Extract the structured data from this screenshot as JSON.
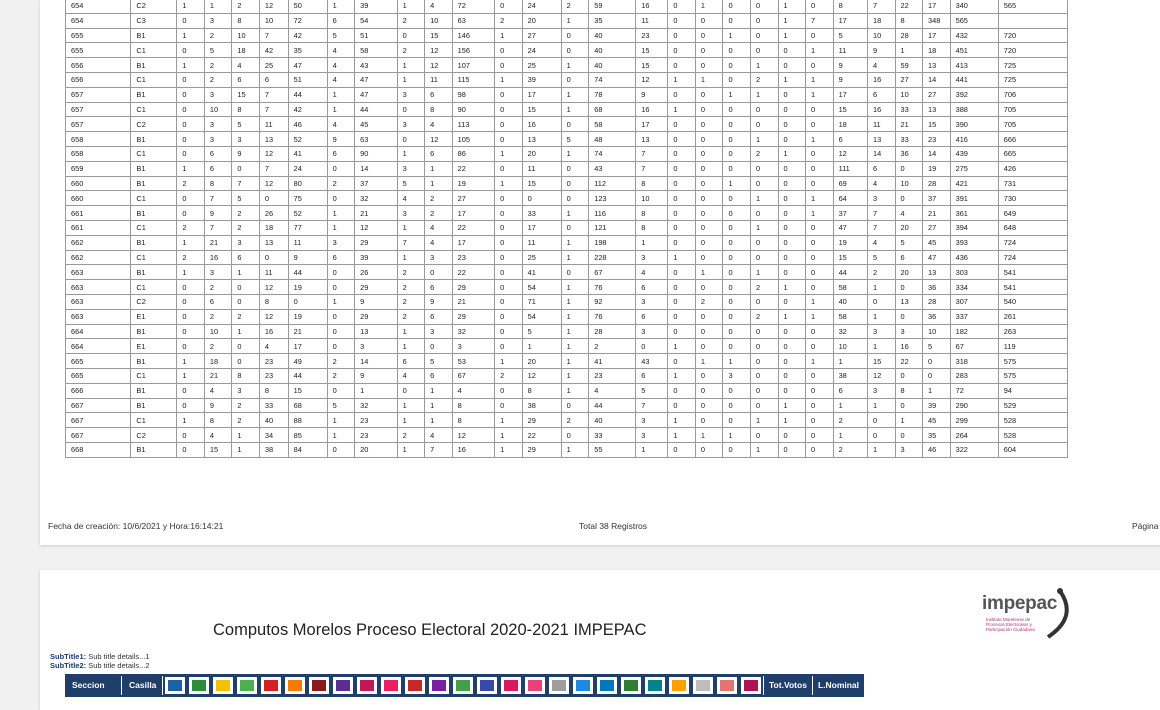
{
  "table": {
    "rows": [
      [
        "654",
        "C2",
        "1",
        "1",
        "2",
        "12",
        "50",
        "1",
        "39",
        "1",
        "4",
        "72",
        "0",
        "24",
        "2",
        "59",
        "16",
        "0",
        "1",
        "0",
        "0",
        "1",
        "0",
        "8",
        "7",
        "22",
        "17",
        "340",
        "565"
      ],
      [
        "654",
        "C3",
        "0",
        "3",
        "8",
        "10",
        "72",
        "6",
        "54",
        "2",
        "10",
        "63",
        "2",
        "20",
        "1",
        "35",
        "11",
        "0",
        "0",
        "0",
        "0",
        "1",
        "7",
        "17",
        "18",
        "8",
        "348",
        "565",
        ""
      ],
      [
        "655",
        "B1",
        "1",
        "2",
        "10",
        "7",
        "42",
        "5",
        "51",
        "0",
        "15",
        "146",
        "1",
        "27",
        "0",
        "40",
        "23",
        "0",
        "0",
        "1",
        "0",
        "1",
        "0",
        "5",
        "10",
        "28",
        "17",
        "432",
        "720"
      ],
      [
        "655",
        "C1",
        "0",
        "5",
        "18",
        "42",
        "35",
        "4",
        "58",
        "2",
        "12",
        "156",
        "0",
        "24",
        "0",
        "40",
        "15",
        "0",
        "0",
        "0",
        "0",
        "0",
        "1",
        "11",
        "9",
        "1",
        "18",
        "451",
        "720"
      ],
      [
        "656",
        "B1",
        "1",
        "2",
        "4",
        "25",
        "47",
        "4",
        "43",
        "1",
        "12",
        "107",
        "0",
        "25",
        "1",
        "40",
        "15",
        "0",
        "0",
        "0",
        "1",
        "0",
        "0",
        "9",
        "4",
        "59",
        "13",
        "413",
        "725"
      ],
      [
        "656",
        "C1",
        "0",
        "2",
        "6",
        "6",
        "51",
        "4",
        "47",
        "1",
        "11",
        "115",
        "1",
        "39",
        "0",
        "74",
        "12",
        "1",
        "1",
        "0",
        "2",
        "1",
        "1",
        "9",
        "16",
        "27",
        "14",
        "441",
        "725"
      ],
      [
        "657",
        "B1",
        "0",
        "3",
        "15",
        "7",
        "44",
        "1",
        "47",
        "3",
        "6",
        "98",
        "0",
        "17",
        "1",
        "78",
        "9",
        "0",
        "0",
        "1",
        "1",
        "0",
        "1",
        "17",
        "6",
        "10",
        "27",
        "392",
        "706"
      ],
      [
        "657",
        "C1",
        "0",
        "10",
        "8",
        "7",
        "42",
        "1",
        "44",
        "0",
        "8",
        "90",
        "0",
        "15",
        "1",
        "68",
        "16",
        "1",
        "0",
        "0",
        "0",
        "0",
        "0",
        "15",
        "16",
        "33",
        "13",
        "388",
        "705"
      ],
      [
        "657",
        "C2",
        "0",
        "3",
        "5",
        "11",
        "46",
        "4",
        "45",
        "3",
        "4",
        "113",
        "0",
        "16",
        "0",
        "58",
        "17",
        "0",
        "0",
        "0",
        "0",
        "0",
        "0",
        "18",
        "11",
        "21",
        "15",
        "390",
        "705"
      ],
      [
        "658",
        "B1",
        "0",
        "3",
        "3",
        "13",
        "52",
        "9",
        "63",
        "0",
        "12",
        "105",
        "0",
        "13",
        "5",
        "48",
        "13",
        "0",
        "0",
        "0",
        "1",
        "0",
        "1",
        "6",
        "13",
        "33",
        "23",
        "416",
        "666"
      ],
      [
        "658",
        "C1",
        "0",
        "6",
        "9",
        "12",
        "41",
        "6",
        "90",
        "1",
        "6",
        "86",
        "1",
        "20",
        "1",
        "74",
        "7",
        "0",
        "0",
        "0",
        "2",
        "1",
        "0",
        "12",
        "14",
        "36",
        "14",
        "439",
        "665"
      ],
      [
        "659",
        "B1",
        "1",
        "6",
        "0",
        "7",
        "24",
        "0",
        "14",
        "3",
        "1",
        "22",
        "0",
        "11",
        "0",
        "43",
        "7",
        "0",
        "0",
        "0",
        "0",
        "0",
        "0",
        "111",
        "6",
        "0",
        "19",
        "275",
        "426"
      ],
      [
        "660",
        "B1",
        "2",
        "8",
        "7",
        "12",
        "80",
        "2",
        "37",
        "5",
        "1",
        "19",
        "1",
        "15",
        "0",
        "112",
        "8",
        "0",
        "0",
        "1",
        "0",
        "0",
        "0",
        "69",
        "4",
        "10",
        "28",
        "421",
        "731"
      ],
      [
        "660",
        "C1",
        "0",
        "7",
        "5",
        "0",
        "75",
        "0",
        "32",
        "4",
        "2",
        "27",
        "0",
        "0",
        "0",
        "123",
        "10",
        "0",
        "0",
        "0",
        "1",
        "0",
        "1",
        "64",
        "3",
        "0",
        "37",
        "391",
        "730"
      ],
      [
        "661",
        "B1",
        "0",
        "9",
        "2",
        "26",
        "52",
        "1",
        "21",
        "3",
        "2",
        "17",
        "0",
        "33",
        "1",
        "116",
        "8",
        "0",
        "0",
        "0",
        "0",
        "0",
        "1",
        "37",
        "7",
        "4",
        "21",
        "361",
        "649"
      ],
      [
        "661",
        "C1",
        "2",
        "7",
        "2",
        "18",
        "77",
        "1",
        "12",
        "1",
        "4",
        "22",
        "0",
        "17",
        "0",
        "121",
        "8",
        "0",
        "0",
        "0",
        "1",
        "0",
        "0",
        "47",
        "7",
        "20",
        "27",
        "394",
        "648"
      ],
      [
        "662",
        "B1",
        "1",
        "21",
        "3",
        "13",
        "11",
        "3",
        "29",
        "7",
        "4",
        "17",
        "0",
        "11",
        "1",
        "198",
        "1",
        "0",
        "0",
        "0",
        "0",
        "0",
        "0",
        "19",
        "4",
        "5",
        "45",
        "393",
        "724"
      ],
      [
        "662",
        "C1",
        "2",
        "16",
        "6",
        "0",
        "9",
        "6",
        "39",
        "1",
        "3",
        "23",
        "0",
        "25",
        "1",
        "228",
        "3",
        "1",
        "0",
        "0",
        "0",
        "0",
        "0",
        "15",
        "5",
        "6",
        "47",
        "436",
        "724"
      ],
      [
        "663",
        "B1",
        "1",
        "3",
        "1",
        "11",
        "44",
        "0",
        "26",
        "2",
        "0",
        "22",
        "0",
        "41",
        "0",
        "67",
        "4",
        "0",
        "1",
        "0",
        "1",
        "0",
        "0",
        "44",
        "2",
        "20",
        "13",
        "303",
        "541"
      ],
      [
        "663",
        "C1",
        "0",
        "2",
        "0",
        "12",
        "19",
        "0",
        "29",
        "2",
        "6",
        "29",
        "0",
        "54",
        "1",
        "76",
        "6",
        "0",
        "0",
        "0",
        "2",
        "1",
        "0",
        "58",
        "1",
        "0",
        "36",
        "334",
        "541"
      ],
      [
        "663",
        "C2",
        "0",
        "6",
        "0",
        "8",
        "0",
        "1",
        "9",
        "2",
        "9",
        "21",
        "0",
        "71",
        "1",
        "92",
        "3",
        "0",
        "2",
        "0",
        "0",
        "0",
        "1",
        "40",
        "0",
        "13",
        "28",
        "307",
        "540"
      ],
      [
        "663",
        "E1",
        "0",
        "2",
        "2",
        "12",
        "19",
        "0",
        "29",
        "2",
        "6",
        "29",
        "0",
        "54",
        "1",
        "76",
        "6",
        "0",
        "0",
        "0",
        "2",
        "1",
        "1",
        "58",
        "1",
        "0",
        "36",
        "337",
        "261"
      ],
      [
        "664",
        "B1",
        "0",
        "10",
        "1",
        "16",
        "21",
        "0",
        "13",
        "1",
        "3",
        "32",
        "0",
        "5",
        "1",
        "28",
        "3",
        "0",
        "0",
        "0",
        "0",
        "0",
        "0",
        "32",
        "3",
        "3",
        "10",
        "182",
        "263"
      ],
      [
        "664",
        "E1",
        "0",
        "2",
        "0",
        "4",
        "17",
        "0",
        "3",
        "1",
        "0",
        "3",
        "0",
        "1",
        "1",
        "2",
        "0",
        "1",
        "0",
        "0",
        "0",
        "0",
        "0",
        "10",
        "1",
        "16",
        "5",
        "67",
        "119"
      ],
      [
        "665",
        "B1",
        "1",
        "18",
        "0",
        "23",
        "49",
        "2",
        "14",
        "6",
        "5",
        "53",
        "1",
        "20",
        "1",
        "41",
        "43",
        "0",
        "1",
        "1",
        "0",
        "0",
        "1",
        "1",
        "15",
        "22",
        "0",
        "318",
        "575"
      ],
      [
        "665",
        "C1",
        "1",
        "21",
        "8",
        "23",
        "44",
        "2",
        "9",
        "4",
        "6",
        "67",
        "2",
        "12",
        "1",
        "23",
        "6",
        "1",
        "0",
        "3",
        "0",
        "0",
        "0",
        "38",
        "12",
        "0",
        "0",
        "283",
        "575"
      ],
      [
        "666",
        "B1",
        "0",
        "4",
        "3",
        "8",
        "15",
        "0",
        "1",
        "0",
        "1",
        "4",
        "0",
        "8",
        "1",
        "4",
        "5",
        "0",
        "0",
        "0",
        "0",
        "0",
        "0",
        "6",
        "3",
        "8",
        "1",
        "72",
        "94"
      ],
      [
        "667",
        "B1",
        "0",
        "9",
        "2",
        "33",
        "68",
        "5",
        "32",
        "1",
        "1",
        "8",
        "0",
        "38",
        "0",
        "44",
        "7",
        "0",
        "0",
        "0",
        "0",
        "1",
        "0",
        "1",
        "1",
        "0",
        "39",
        "290",
        "529"
      ],
      [
        "667",
        "C1",
        "1",
        "8",
        "2",
        "40",
        "88",
        "1",
        "23",
        "1",
        "1",
        "8",
        "1",
        "29",
        "2",
        "40",
        "3",
        "1",
        "0",
        "0",
        "1",
        "1",
        "0",
        "2",
        "0",
        "1",
        "45",
        "299",
        "528"
      ],
      [
        "667",
        "C2",
        "0",
        "4",
        "1",
        "34",
        "85",
        "1",
        "23",
        "2",
        "4",
        "12",
        "1",
        "22",
        "0",
        "33",
        "3",
        "1",
        "1",
        "1",
        "0",
        "0",
        "0",
        "1",
        "0",
        "0",
        "35",
        "264",
        "528"
      ],
      [
        "668",
        "B1",
        "0",
        "15",
        "1",
        "38",
        "84",
        "0",
        "20",
        "1",
        "7",
        "16",
        "1",
        "29",
        "1",
        "55",
        "1",
        "0",
        "0",
        "0",
        "1",
        "0",
        "0",
        "2",
        "1",
        "3",
        "46",
        "322",
        "604"
      ]
    ]
  },
  "footer": {
    "created": "Fecha de creación: 10/6/2021  y Hora:16:14:21",
    "total": "Total 38 Registros",
    "page": "Página"
  },
  "report": {
    "title": "Computos Morelos Proceso Electoral 2020-2021 IMPEPAC",
    "subtitle1_label": "SubTitle1:",
    "subtitle1_value": " Sub title details...1",
    "subtitle2_label": "SubTitle2:",
    "subtitle2_value": " Sub title details...2",
    "logo_text": "impepac",
    "logo_subtext": "Instituto Morelense de Procesos Electorales y Participación Ciudadana"
  },
  "header": {
    "seccion": "Seccion",
    "casilla": "Casilla",
    "tot_votos": "Tot.Votos",
    "l_nominal": "L.Nominal",
    "party_logos": [
      {
        "icon": "pan-logo-icon",
        "color": "#1f5fa8"
      },
      {
        "icon": "pri-logo-icon",
        "color": "#2e8b3a"
      },
      {
        "icon": "prd-logo-icon",
        "color": "#f2c200"
      },
      {
        "icon": "pvem-logo-icon",
        "color": "#4caf50"
      },
      {
        "icon": "pt-logo-icon",
        "color": "#d32020"
      },
      {
        "icon": "mc-logo-icon",
        "color": "#f57c00"
      },
      {
        "icon": "morena-logo-icon",
        "color": "#8b1a1a"
      },
      {
        "icon": "pes-logo-icon",
        "color": "#5c2d91"
      },
      {
        "icon": "rsp-logo-icon",
        "color": "#c2185b"
      },
      {
        "icon": "fxm-logo-icon",
        "color": "#e91e63"
      },
      {
        "icon": "psd-logo-icon",
        "color": "#c62828"
      },
      {
        "icon": "party-12-logo-icon",
        "color": "#7b1fa2"
      },
      {
        "icon": "party-13-logo-icon",
        "color": "#43a047"
      },
      {
        "icon": "party-14-logo-icon",
        "color": "#3949ab"
      },
      {
        "icon": "mas-logo-icon",
        "color": "#d81b60"
      },
      {
        "icon": "party-16-logo-icon",
        "color": "#ec407a"
      },
      {
        "icon": "party-17-logo-icon",
        "color": "#9e9e9e"
      },
      {
        "icon": "party-18-logo-icon",
        "color": "#1e88e5"
      },
      {
        "icon": "party-19-logo-icon",
        "color": "#0277bd"
      },
      {
        "icon": "party-20-logo-icon",
        "color": "#2e7d32"
      },
      {
        "icon": "mas2-logo-icon",
        "color": "#00838f"
      },
      {
        "icon": "party-22-logo-icon",
        "color": "#ffa000"
      },
      {
        "icon": "party-23-logo-icon",
        "color": "#bdbdbd"
      },
      {
        "icon": "party-24-logo-icon",
        "color": "#e57373"
      },
      {
        "icon": "party-25-logo-icon",
        "color": "#ad1457"
      }
    ]
  },
  "colors": {
    "header_bg": "#1f3e6a",
    "page_bg": "#ffffff",
    "canvas_bg": "#f1f1f1"
  }
}
